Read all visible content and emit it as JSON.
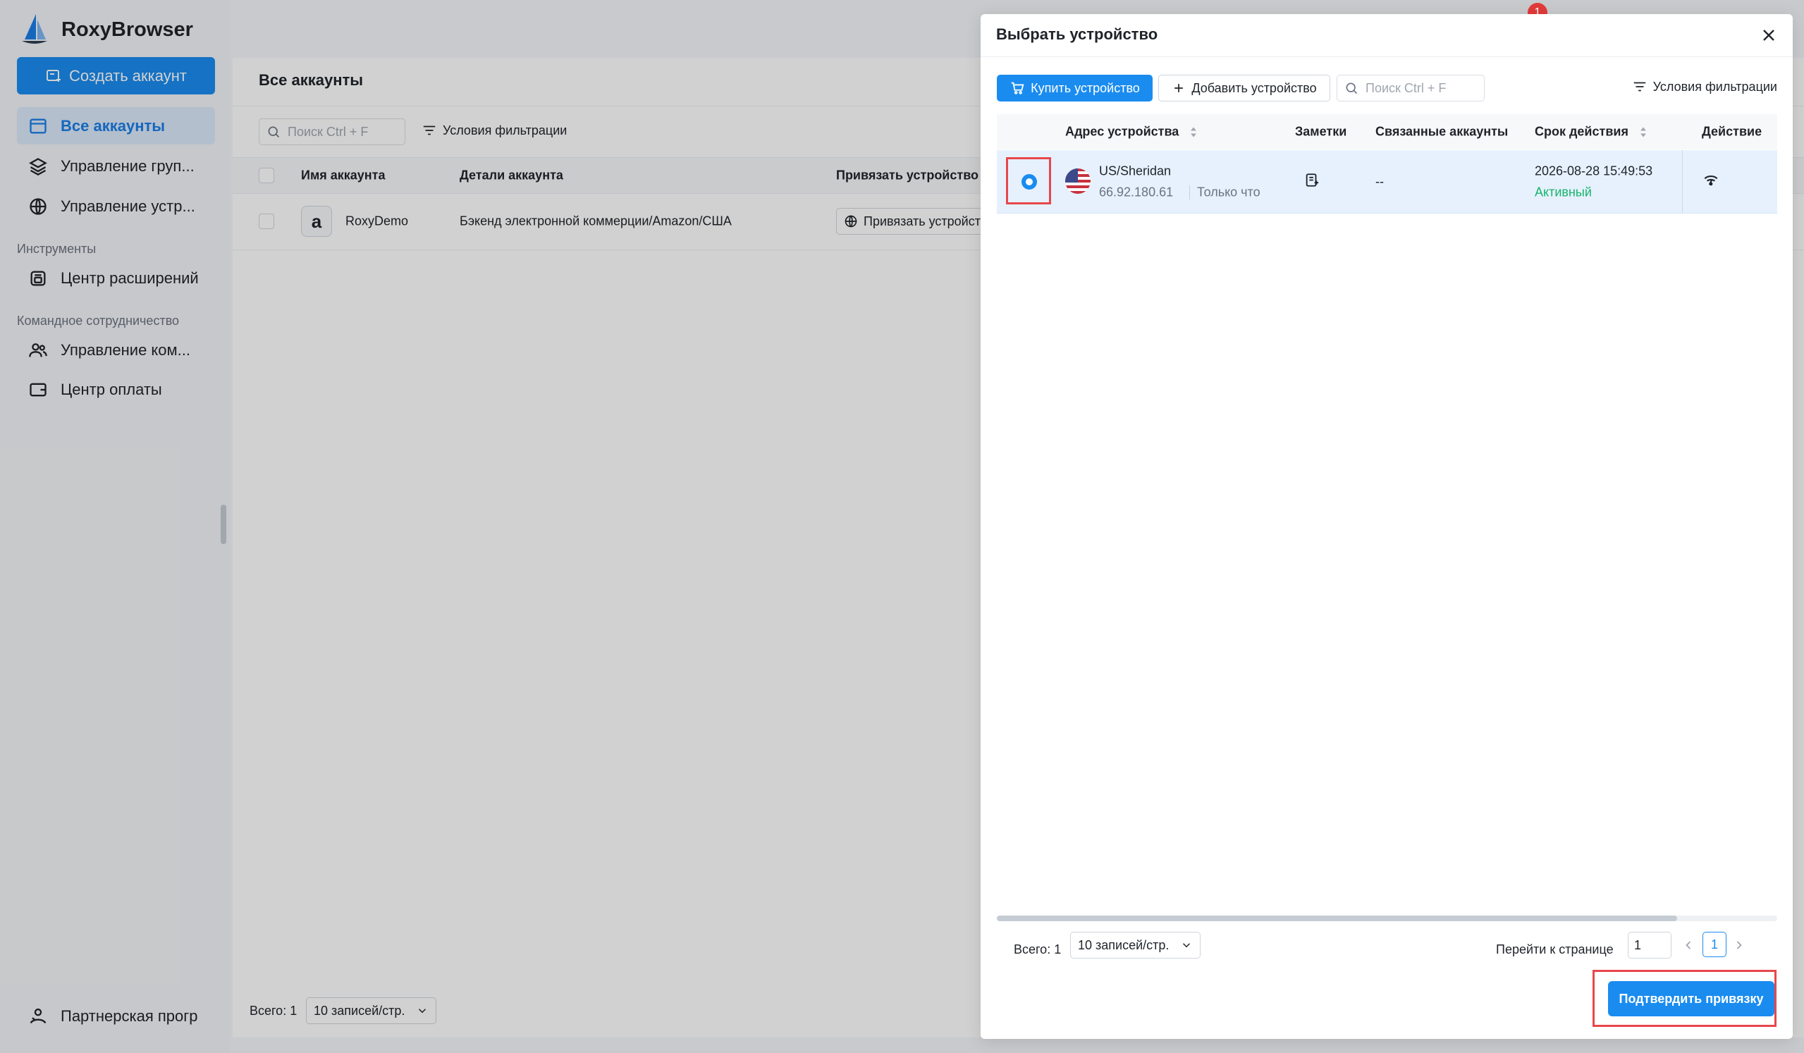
{
  "app": {
    "name": "RoxyBrowser"
  },
  "sidebar": {
    "create_button": "Создать аккаунт",
    "items": [
      {
        "label": "Все аккаунты",
        "icon": "window-icon",
        "active": true
      },
      {
        "label": "Управление груп...",
        "icon": "layers-icon"
      },
      {
        "label": "Управление устр...",
        "icon": "globe-icon"
      }
    ],
    "section_tools": "Инструменты",
    "tools_items": [
      {
        "label": "Центр расширений",
        "icon": "extension-icon"
      }
    ],
    "section_team": "Командное сотрудничество",
    "team_items": [
      {
        "label": "Управление ком...",
        "icon": "users-icon"
      },
      {
        "label": "Центр оплаты",
        "icon": "wallet-icon"
      }
    ],
    "partner": {
      "label": "Партнерская прогр",
      "icon": "partner-icon"
    }
  },
  "notification_badge": "1",
  "main": {
    "title": "Все аккаунты",
    "search_placeholder": "Поиск Ctrl + F",
    "filter_label": "Условия фильтрации",
    "columns": [
      "Имя аккаунта",
      "Детали аккаунта",
      "Привязать устройство"
    ],
    "rows": [
      {
        "name": "RoxyDemo",
        "details": "Бэкенд электронной коммерции/Amazon/США",
        "bind_label": "Привязать устройство"
      }
    ],
    "total": "Всего: 1",
    "page_size": "10 записей/стр."
  },
  "modal": {
    "title": "Выбрать устройство",
    "buy_button": "Купить устройство",
    "add_button": "Добавить устройство",
    "search_placeholder": "Поиск Ctrl + F",
    "filter_label": "Условия фильтрации",
    "columns": {
      "address": "Адрес устройства",
      "notes": "Заметки",
      "linked": "Связанные аккаунты",
      "expiry": "Срок действия",
      "action": "Действие"
    },
    "rows": [
      {
        "location": "US/Sheridan",
        "ip": "66.92.180.61",
        "checked": "Только что",
        "linked": "--",
        "expiry": "2026-08-28 15:49:53",
        "status": "Активный",
        "selected": true
      }
    ],
    "total": "Всего: 1",
    "page_size": "10 записей/стр.",
    "goto_label": "Перейти к странице",
    "goto_value": "1",
    "current_page": "1",
    "confirm_button": "Подтвердить привязку",
    "colors": {
      "accent": "#1a8cf0",
      "active_status": "#18b36b",
      "highlight": "#e8474c"
    }
  }
}
